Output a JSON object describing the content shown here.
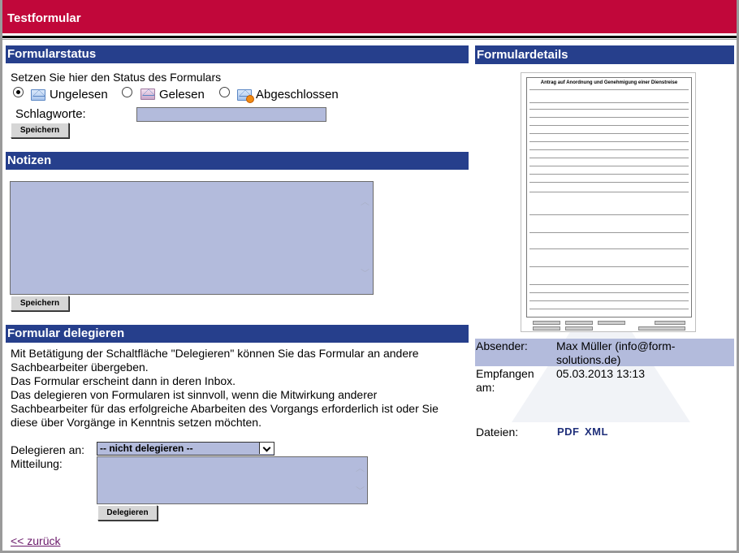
{
  "window": {
    "title": "Testformular"
  },
  "status": {
    "header": "Formularstatus",
    "intro": "Setzen Sie hier den Status des Formulars",
    "options": [
      {
        "label": "Ungelesen",
        "icon": "envelope-closed-icon",
        "checked": true
      },
      {
        "label": "Gelesen",
        "icon": "envelope-open-icon",
        "checked": false
      },
      {
        "label": "Abgeschlossen",
        "icon": "envelope-done-icon",
        "checked": false
      }
    ],
    "keywords_label": "Schlagworte:",
    "keywords_value": "",
    "save_label": "Speichern"
  },
  "notes": {
    "header": "Notizen",
    "value": "",
    "save_label": "Speichern"
  },
  "delegate": {
    "header": "Formular delegieren",
    "description": [
      "Mit Betätigung der Schaltfläche \"Delegieren\" können Sie das Formular an andere",
      "Sachbearbeiter übergeben.",
      "Das Formular erscheint dann in deren Inbox.",
      "Das delegieren von Formularen ist sinnvoll, wenn die Mitwirkung anderer",
      "Sachbearbeiter für das erfolgreiche Abarbeiten des Vorgangs erforderlich ist oder Sie",
      "diese über Vorgänge in Kenntnis setzen möchten."
    ],
    "to_label": "Delegieren an:",
    "to_selected": "-- nicht delegieren --",
    "message_label": "Mitteilung:",
    "message_value": "",
    "button_label": "Delegieren"
  },
  "back_link": "<< zurück",
  "details": {
    "header": "Formulardetails",
    "thumbnail_title": "Antrag auf Anordnung und Genehmigung einer Dienstreise",
    "sender_label": "Absender:",
    "sender_value_line1": "Max Müller  (info@form-",
    "sender_value_line2": "solutions.de)",
    "received_label_line1": "Empfangen",
    "received_label_line2": "am:",
    "received_value": "05.03.2013 13:13",
    "files_label": "Dateien:",
    "files": [
      "PDF",
      "XML"
    ]
  },
  "colors": {
    "titlebar": "#c1073a",
    "section_header": "#263f8c",
    "field": "#b3bbdc"
  }
}
